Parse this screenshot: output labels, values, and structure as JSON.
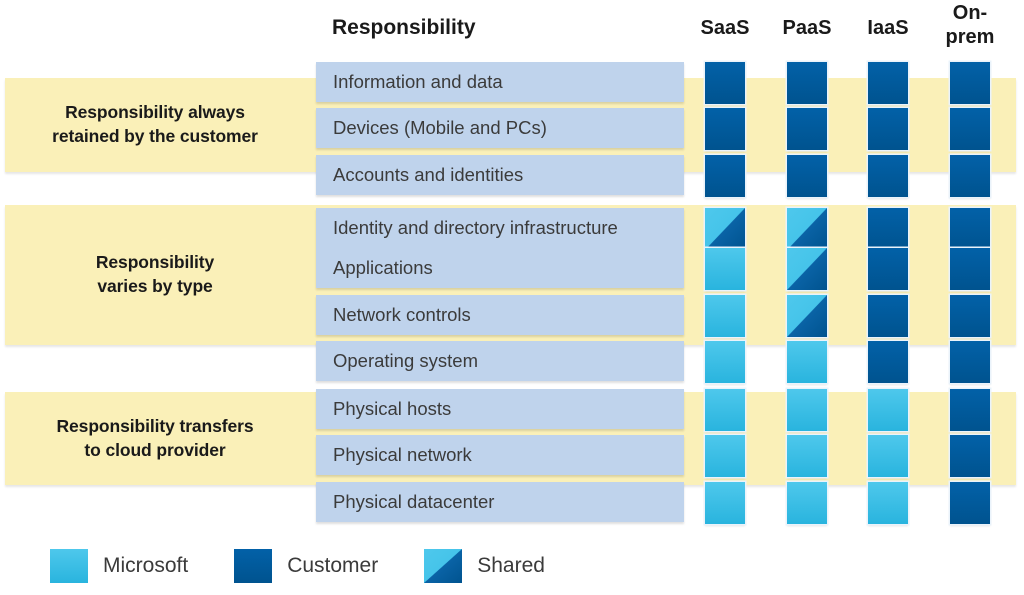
{
  "header": {
    "responsibility_label": "Responsibility",
    "columns": [
      {
        "id": "saas",
        "label": "SaaS",
        "lines": [
          "SaaS"
        ]
      },
      {
        "id": "paas",
        "label": "PaaS",
        "lines": [
          "PaaS"
        ]
      },
      {
        "id": "iaas",
        "label": "IaaS",
        "lines": [
          "IaaS"
        ]
      },
      {
        "id": "onprem",
        "label": "On-prem",
        "lines": [
          "On-",
          "prem"
        ]
      }
    ]
  },
  "groups": [
    {
      "id": "always-customer",
      "label": "Responsibility always retained by the customer",
      "lines": [
        "Responsibility always",
        "retained by the customer"
      ]
    },
    {
      "id": "varies-by-type",
      "label": "Responsibility varies by type",
      "lines": [
        "Responsibility",
        "varies by type"
      ]
    },
    {
      "id": "transfers-to-provider",
      "label": "Responsibility transfers to cloud provider",
      "lines": [
        "Responsibility transfers",
        "to cloud provider"
      ]
    }
  ],
  "rows": [
    {
      "group": "always-customer",
      "label": "Information and data",
      "cells": [
        "customer",
        "customer",
        "customer",
        "customer"
      ]
    },
    {
      "group": "always-customer",
      "label": "Devices (Mobile and PCs)",
      "cells": [
        "customer",
        "customer",
        "customer",
        "customer"
      ]
    },
    {
      "group": "always-customer",
      "label": "Accounts and identities",
      "cells": [
        "customer",
        "customer",
        "customer",
        "customer"
      ]
    },
    {
      "group": "varies-by-type",
      "label": "Identity and directory infrastructure",
      "cells": [
        "shared",
        "shared",
        "customer",
        "customer"
      ]
    },
    {
      "group": "varies-by-type",
      "label": "Applications",
      "cells": [
        "microsoft",
        "shared",
        "customer",
        "customer"
      ]
    },
    {
      "group": "varies-by-type",
      "label": "Network controls",
      "cells": [
        "microsoft",
        "shared",
        "customer",
        "customer"
      ]
    },
    {
      "group": "varies-by-type",
      "label": "Operating system",
      "cells": [
        "microsoft",
        "microsoft",
        "customer",
        "customer"
      ]
    },
    {
      "group": "transfers-to-provider",
      "label": "Physical hosts",
      "cells": [
        "microsoft",
        "microsoft",
        "microsoft",
        "customer"
      ]
    },
    {
      "group": "transfers-to-provider",
      "label": "Physical network",
      "cells": [
        "microsoft",
        "microsoft",
        "microsoft",
        "customer"
      ]
    },
    {
      "group": "transfers-to-provider",
      "label": "Physical datacenter",
      "cells": [
        "microsoft",
        "microsoft",
        "microsoft",
        "customer"
      ]
    }
  ],
  "legend": [
    {
      "id": "microsoft",
      "label": "Microsoft",
      "swatch": "microsoft"
    },
    {
      "id": "customer",
      "label": "Customer",
      "swatch": "customer"
    },
    {
      "id": "shared",
      "label": "Shared",
      "swatch": "shared"
    }
  ],
  "colors": {
    "customer": "#005B9F",
    "microsoft": "#3DBFE6",
    "band": "#FAF0B8",
    "row_box": "#BFD3EC",
    "text": "#3B3B3B",
    "heading_text": "#1A1A1A"
  },
  "layout": {
    "band_tops": [
      78,
      205,
      392
    ],
    "band_heights": [
      94,
      140,
      93
    ],
    "row_tops": [
      62,
      108,
      155,
      208,
      248,
      295,
      341,
      389,
      435,
      482
    ],
    "column_lefts": [
      705,
      787,
      868,
      950
    ]
  }
}
